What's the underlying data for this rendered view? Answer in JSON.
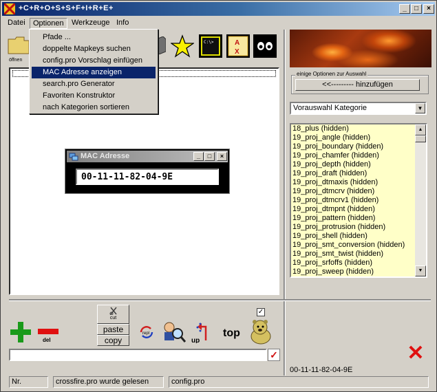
{
  "window": {
    "title": "+C+R+O+S+S+F+I+R+E+"
  },
  "menubar": [
    "Datei",
    "Optionen",
    "Werkzeuge",
    "Info"
  ],
  "dropdown": {
    "items": [
      "Pfade ...",
      "doppelte Mapkeys suchen",
      "config.pro Vorschlag einfügen",
      "MAC Adresse anzeigen",
      "search.pro Generator",
      "Favoriten Konstruktor",
      "nach Kategorien sortieren"
    ],
    "selected_index": 3
  },
  "toolbar": {
    "open_label": "öffnen",
    "icons": [
      "folder-icon",
      "book-icon",
      "star-icon",
      "terminal-icon",
      "ax-icon",
      "eyes-icon"
    ]
  },
  "mac_dialog": {
    "title": "MAC Adresse",
    "value": "00-11-11-82-04-9E"
  },
  "right_panel": {
    "group_label": "einige Optionen zur Auswahl",
    "add_button": "<<---------  hinzufügen",
    "select_value": "Vorauswahl Kategorie",
    "list": [
      "18_plus (hidden)",
      "19_proj_angle (hidden)",
      "19_proj_boundary (hidden)",
      "19_proj_chamfer (hidden)",
      "19_proj_depth (hidden)",
      "19_proj_draft (hidden)",
      "19_proj_dtmaxis (hidden)",
      "19_proj_dtmcrv (hidden)",
      "19_proj_dtmcrv1 (hidden)",
      "19_proj_dtmpnt (hidden)",
      "19_proj_pattern (hidden)",
      "19_proj_protrusion (hidden)",
      "19_proj_shell (hidden)",
      "19_proj_smt_conversion (hidden)",
      "19_proj_smt_twist (hidden)",
      "19_proj_srfoffs (hidden)",
      "19_proj_sweep (hidden)"
    ],
    "mac_readout": "00-11-11-82-04-9E"
  },
  "bottom": {
    "del_label": "del",
    "cut_label": "cut",
    "paste_label": "paste",
    "copy_label": "copy",
    "repl_label": "repl",
    "up_label": "up",
    "top_label": "top",
    "checkbox_checked": true,
    "command_value": ""
  },
  "statusbar": [
    "Nr.",
    "crossfire.pro wurde gelesen",
    "config.pro"
  ],
  "colors": {
    "selection": "#0a246a",
    "list_bg": "#ffffc8",
    "accent_red": "#e01010",
    "accent_green": "#1a9a1a"
  }
}
